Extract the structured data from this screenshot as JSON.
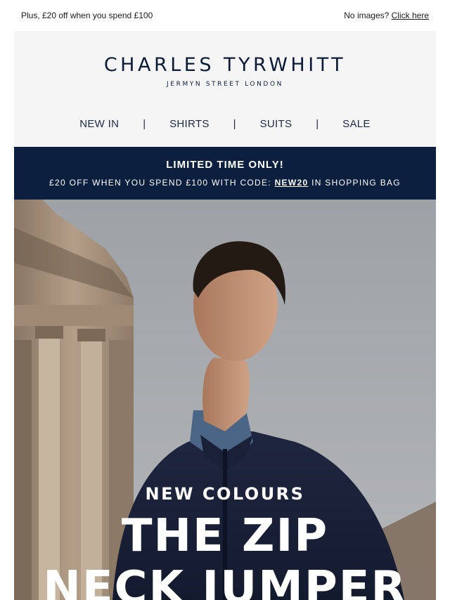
{
  "preheader": {
    "left_text": "Plus, £20 off when you spend £100",
    "no_images_text": "No images?",
    "click_here_link": "Click here"
  },
  "header": {
    "logo_text": "CHARLES TYRWHITT",
    "logo_subtext": "JERMYN STREET LONDON",
    "nav": [
      "NEW IN",
      "SHIRTS",
      "SUITS",
      "SALE"
    ],
    "nav_separator": "|"
  },
  "promo": {
    "title": "LIMITED TIME ONLY!",
    "line_before": "£20 OFF WHEN YOU SPEND £100 WITH CODE:",
    "code": "NEW20",
    "line_after": "IN SHOPPING BAG",
    "background_color": "#0c1f3f"
  },
  "hero": {
    "subtitle": "NEW COLOURS",
    "title_line1": "THE ZIP",
    "title_line2": "NECK JUMPER"
  }
}
